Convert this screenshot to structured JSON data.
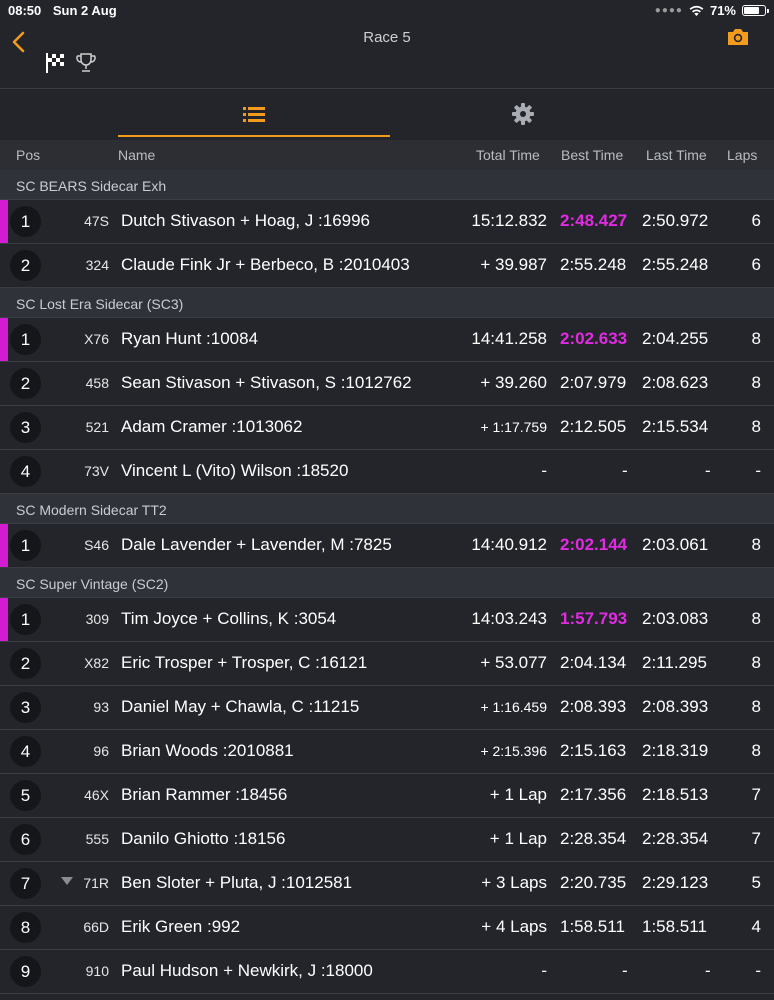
{
  "status": {
    "time": "08:50",
    "date": "Sun 2 Aug",
    "battery": "71%",
    "battery_level": 0.71
  },
  "nav": {
    "title": "Race 5"
  },
  "columns": {
    "pos": "Pos",
    "name": "Name",
    "total": "Total Time",
    "best": "Best Time",
    "last": "Last Time",
    "laps": "Laps"
  },
  "colors": {
    "accent": "#f29b1d",
    "leader": "#d21cd2",
    "best_lap": "#e22ae2",
    "background": "#23252b"
  },
  "classes": [
    {
      "name": "SC BEARS Sidecar Exh",
      "rows": [
        {
          "pos": "1",
          "num": "47S",
          "name": "Dutch Stivason + Hoag, J :16996",
          "total": "15:12.832",
          "best": "2:48.427",
          "last": "2:50.972",
          "laps": "6",
          "leader": true
        },
        {
          "pos": "2",
          "num": "324",
          "name": "Claude Fink Jr + Berbeco, B :2010403",
          "total": "+ 39.987",
          "best": "2:55.248",
          "last": "2:55.248",
          "laps": "6"
        }
      ]
    },
    {
      "name": "SC Lost Era Sidecar (SC3)",
      "rows": [
        {
          "pos": "1",
          "num": "X76",
          "name": "Ryan Hunt :10084",
          "total": "14:41.258",
          "best": "2:02.633",
          "last": "2:04.255",
          "laps": "8",
          "leader": true
        },
        {
          "pos": "2",
          "num": "458",
          "name": "Sean Stivason + Stivason, S :1012762",
          "total": "+ 39.260",
          "best": "2:07.979",
          "last": "2:08.623",
          "laps": "8"
        },
        {
          "pos": "3",
          "num": "521",
          "name": "Adam Cramer :1013062",
          "total": "+ 1:17.759",
          "best": "2:12.505",
          "last": "2:15.534",
          "laps": "8",
          "small": true
        },
        {
          "pos": "4",
          "num": "73V",
          "name": "Vincent L (Vito) Wilson :18520",
          "total": "-",
          "best": "-",
          "last": "-",
          "laps": "-",
          "dash": true
        }
      ]
    },
    {
      "name": "SC Modern Sidecar TT2",
      "rows": [
        {
          "pos": "1",
          "num": "S46",
          "name": "Dale Lavender + Lavender, M :7825",
          "total": "14:40.912",
          "best": "2:02.144",
          "last": "2:03.061",
          "laps": "8",
          "leader": true
        }
      ]
    },
    {
      "name": "SC Super Vintage (SC2)",
      "rows": [
        {
          "pos": "1",
          "num": "309",
          "name": "Tim Joyce + Collins, K :3054",
          "total": "14:03.243",
          "best": "1:57.793",
          "last": "2:03.083",
          "laps": "8",
          "leader": true
        },
        {
          "pos": "2",
          "num": "X82",
          "name": "Eric Trosper + Trosper, C :16121",
          "total": "+ 53.077",
          "best": "2:04.134",
          "last": "2:11.295",
          "laps": "8"
        },
        {
          "pos": "3",
          "num": "93",
          "name": "Daniel May + Chawla, C :11215",
          "total": "+ 1:16.459",
          "best": "2:08.393",
          "last": "2:08.393",
          "laps": "8",
          "small": true
        },
        {
          "pos": "4",
          "num": "96",
          "name": "Brian Woods :2010881",
          "total": "+ 2:15.396",
          "best": "2:15.163",
          "last": "2:18.319",
          "laps": "8",
          "small": true
        },
        {
          "pos": "5",
          "num": "46X",
          "name": "Brian Rammer :18456",
          "total": "+ 1 Lap",
          "best": "2:17.356",
          "last": "2:18.513",
          "laps": "7"
        },
        {
          "pos": "6",
          "num": "555",
          "name": "Danilo Ghiotto :18156",
          "total": "+ 1 Lap",
          "best": "2:28.354",
          "last": "2:28.354",
          "laps": "7"
        },
        {
          "pos": "7",
          "num": "71R",
          "name": "Ben Sloter + Pluta, J :1012581",
          "total": "+ 3 Laps",
          "best": "2:20.735",
          "last": "2:29.123",
          "laps": "5",
          "trend": "down"
        },
        {
          "pos": "8",
          "num": "66D",
          "name": "Erik Green :992",
          "total": "+ 4 Laps",
          "best": "1:58.511",
          "last": "1:58.511",
          "laps": "4"
        },
        {
          "pos": "9",
          "num": "910",
          "name": "Paul Hudson + Newkirk, J :18000",
          "total": "-",
          "best": "-",
          "last": "-",
          "laps": "-",
          "dash": true
        }
      ]
    }
  ]
}
